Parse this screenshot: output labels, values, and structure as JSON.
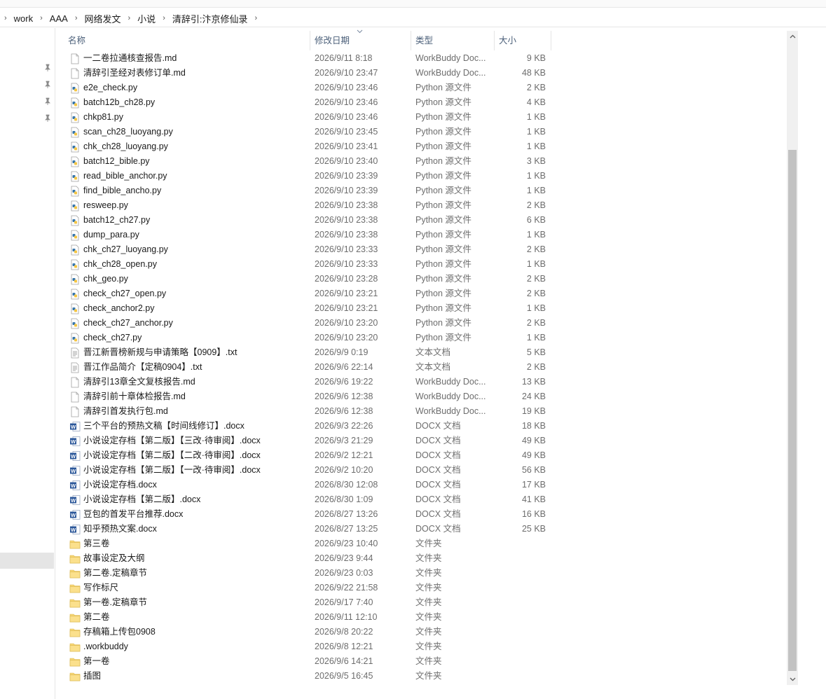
{
  "breadcrumb": [
    "work",
    "AAA",
    "网络发文",
    "小说",
    "清辞引:汴京修仙录"
  ],
  "columns": {
    "name": "名称",
    "date": "修改日期",
    "type": "类型",
    "size": "大小"
  },
  "icons": {
    "doc": "document-icon",
    "py": "python-file-icon",
    "txt": "text-file-icon",
    "word": "word-doc-icon",
    "folder": "folder-icon",
    "pin": "pin-icon"
  },
  "colors": {
    "folder": "#f8d775",
    "word": "#2b579a",
    "python": "#3776ab",
    "selection": "#e5e5e5"
  },
  "files": [
    {
      "icon": "doc",
      "name": "一二卷拉通核查报告.md",
      "date": "2026/9/11 8:18",
      "type": "WorkBuddy Doc...",
      "size": "9 KB"
    },
    {
      "icon": "doc",
      "name": "清辞引圣经对表修订单.md",
      "date": "2026/9/10 23:47",
      "type": "WorkBuddy Doc...",
      "size": "48 KB"
    },
    {
      "icon": "py",
      "name": "e2e_check.py",
      "date": "2026/9/10 23:46",
      "type": "Python 源文件",
      "size": "2 KB"
    },
    {
      "icon": "py",
      "name": "batch12b_ch28.py",
      "date": "2026/9/10 23:46",
      "type": "Python 源文件",
      "size": "4 KB"
    },
    {
      "icon": "py",
      "name": "chkp81.py",
      "date": "2026/9/10 23:46",
      "type": "Python 源文件",
      "size": "1 KB"
    },
    {
      "icon": "py",
      "name": "scan_ch28_luoyang.py",
      "date": "2026/9/10 23:45",
      "type": "Python 源文件",
      "size": "1 KB"
    },
    {
      "icon": "py",
      "name": "chk_ch28_luoyang.py",
      "date": "2026/9/10 23:41",
      "type": "Python 源文件",
      "size": "1 KB"
    },
    {
      "icon": "py",
      "name": "batch12_bible.py",
      "date": "2026/9/10 23:40",
      "type": "Python 源文件",
      "size": "3 KB"
    },
    {
      "icon": "py",
      "name": "read_bible_anchor.py",
      "date": "2026/9/10 23:39",
      "type": "Python 源文件",
      "size": "1 KB"
    },
    {
      "icon": "py",
      "name": "find_bible_ancho.py",
      "date": "2026/9/10 23:39",
      "type": "Python 源文件",
      "size": "1 KB"
    },
    {
      "icon": "py",
      "name": "resweep.py",
      "date": "2026/9/10 23:38",
      "type": "Python 源文件",
      "size": "2 KB"
    },
    {
      "icon": "py",
      "name": "batch12_ch27.py",
      "date": "2026/9/10 23:38",
      "type": "Python 源文件",
      "size": "6 KB"
    },
    {
      "icon": "py",
      "name": "dump_para.py",
      "date": "2026/9/10 23:38",
      "type": "Python 源文件",
      "size": "1 KB"
    },
    {
      "icon": "py",
      "name": "chk_ch27_luoyang.py",
      "date": "2026/9/10 23:33",
      "type": "Python 源文件",
      "size": "2 KB"
    },
    {
      "icon": "py",
      "name": "chk_ch28_open.py",
      "date": "2026/9/10 23:33",
      "type": "Python 源文件",
      "size": "1 KB"
    },
    {
      "icon": "py",
      "name": "chk_geo.py",
      "date": "2026/9/10 23:28",
      "type": "Python 源文件",
      "size": "2 KB"
    },
    {
      "icon": "py",
      "name": "check_ch27_open.py",
      "date": "2026/9/10 23:21",
      "type": "Python 源文件",
      "size": "2 KB"
    },
    {
      "icon": "py",
      "name": "check_anchor2.py",
      "date": "2026/9/10 23:21",
      "type": "Python 源文件",
      "size": "1 KB"
    },
    {
      "icon": "py",
      "name": "check_ch27_anchor.py",
      "date": "2026/9/10 23:20",
      "type": "Python 源文件",
      "size": "2 KB"
    },
    {
      "icon": "py",
      "name": "check_ch27.py",
      "date": "2026/9/10 23:20",
      "type": "Python 源文件",
      "size": "1 KB"
    },
    {
      "icon": "txt",
      "name": "晋江新晋榜新规与申请策略【0909】.txt",
      "date": "2026/9/9 0:19",
      "type": "文本文档",
      "size": "5 KB"
    },
    {
      "icon": "txt",
      "name": "晋江作品简介【定稿0904】.txt",
      "date": "2026/9/6 22:14",
      "type": "文本文档",
      "size": "2 KB"
    },
    {
      "icon": "doc",
      "name": "清辞引13章全文复核报告.md",
      "date": "2026/9/6 19:22",
      "type": "WorkBuddy Doc...",
      "size": "13 KB"
    },
    {
      "icon": "doc",
      "name": "清辞引前十章体检报告.md",
      "date": "2026/9/6 12:38",
      "type": "WorkBuddy Doc...",
      "size": "24 KB"
    },
    {
      "icon": "doc",
      "name": "清辞引首发执行包.md",
      "date": "2026/9/6 12:38",
      "type": "WorkBuddy Doc...",
      "size": "19 KB"
    },
    {
      "icon": "word",
      "name": "三个平台的预热文稿【时间线修订】.docx",
      "date": "2026/9/3 22:26",
      "type": "DOCX 文档",
      "size": "18 KB"
    },
    {
      "icon": "word",
      "name": "小说设定存档【第二版】【三改·待审阅】.docx",
      "date": "2026/9/3 21:29",
      "type": "DOCX 文档",
      "size": "49 KB"
    },
    {
      "icon": "word",
      "name": "小说设定存档【第二版】【二改·待审阅】.docx",
      "date": "2026/9/2 12:21",
      "type": "DOCX 文档",
      "size": "49 KB"
    },
    {
      "icon": "word",
      "name": "小说设定存档【第二版】【一改·待审阅】.docx",
      "date": "2026/9/2 10:20",
      "type": "DOCX 文档",
      "size": "56 KB"
    },
    {
      "icon": "word",
      "name": "小说设定存档.docx",
      "date": "2026/8/30 12:08",
      "type": "DOCX 文档",
      "size": "17 KB"
    },
    {
      "icon": "word",
      "name": "小说设定存档【第二版】.docx",
      "date": "2026/8/30 1:09",
      "type": "DOCX 文档",
      "size": "41 KB"
    },
    {
      "icon": "word",
      "name": "豆包的首发平台推荐.docx",
      "date": "2026/8/27 13:26",
      "type": "DOCX 文档",
      "size": "16 KB"
    },
    {
      "icon": "word",
      "name": "知乎预热文案.docx",
      "date": "2026/8/27 13:25",
      "type": "DOCX 文档",
      "size": "25 KB"
    },
    {
      "icon": "folder",
      "name": "第三卷",
      "date": "2026/9/23 10:40",
      "type": "文件夹",
      "size": ""
    },
    {
      "icon": "folder",
      "name": "故事设定及大纲",
      "date": "2026/9/23 9:44",
      "type": "文件夹",
      "size": ""
    },
    {
      "icon": "folder",
      "name": "第二卷.定稿章节",
      "date": "2026/9/23 0:03",
      "type": "文件夹",
      "size": ""
    },
    {
      "icon": "folder",
      "name": "写作标尺",
      "date": "2026/9/22 21:58",
      "type": "文件夹",
      "size": ""
    },
    {
      "icon": "folder",
      "name": "第一卷.定稿章节",
      "date": "2026/9/17 7:40",
      "type": "文件夹",
      "size": ""
    },
    {
      "icon": "folder",
      "name": "第二卷",
      "date": "2026/9/11 12:10",
      "type": "文件夹",
      "size": ""
    },
    {
      "icon": "folder",
      "name": "存稿箱上传包0908",
      "date": "2026/9/8 20:22",
      "type": "文件夹",
      "size": ""
    },
    {
      "icon": "folder",
      "name": ".workbuddy",
      "date": "2026/9/8 12:21",
      "type": "文件夹",
      "size": ""
    },
    {
      "icon": "folder",
      "name": "第一卷",
      "date": "2026/9/6 14:21",
      "type": "文件夹",
      "size": ""
    },
    {
      "icon": "folder",
      "name": "插图",
      "date": "2026/9/5 16:45",
      "type": "文件夹",
      "size": ""
    }
  ]
}
